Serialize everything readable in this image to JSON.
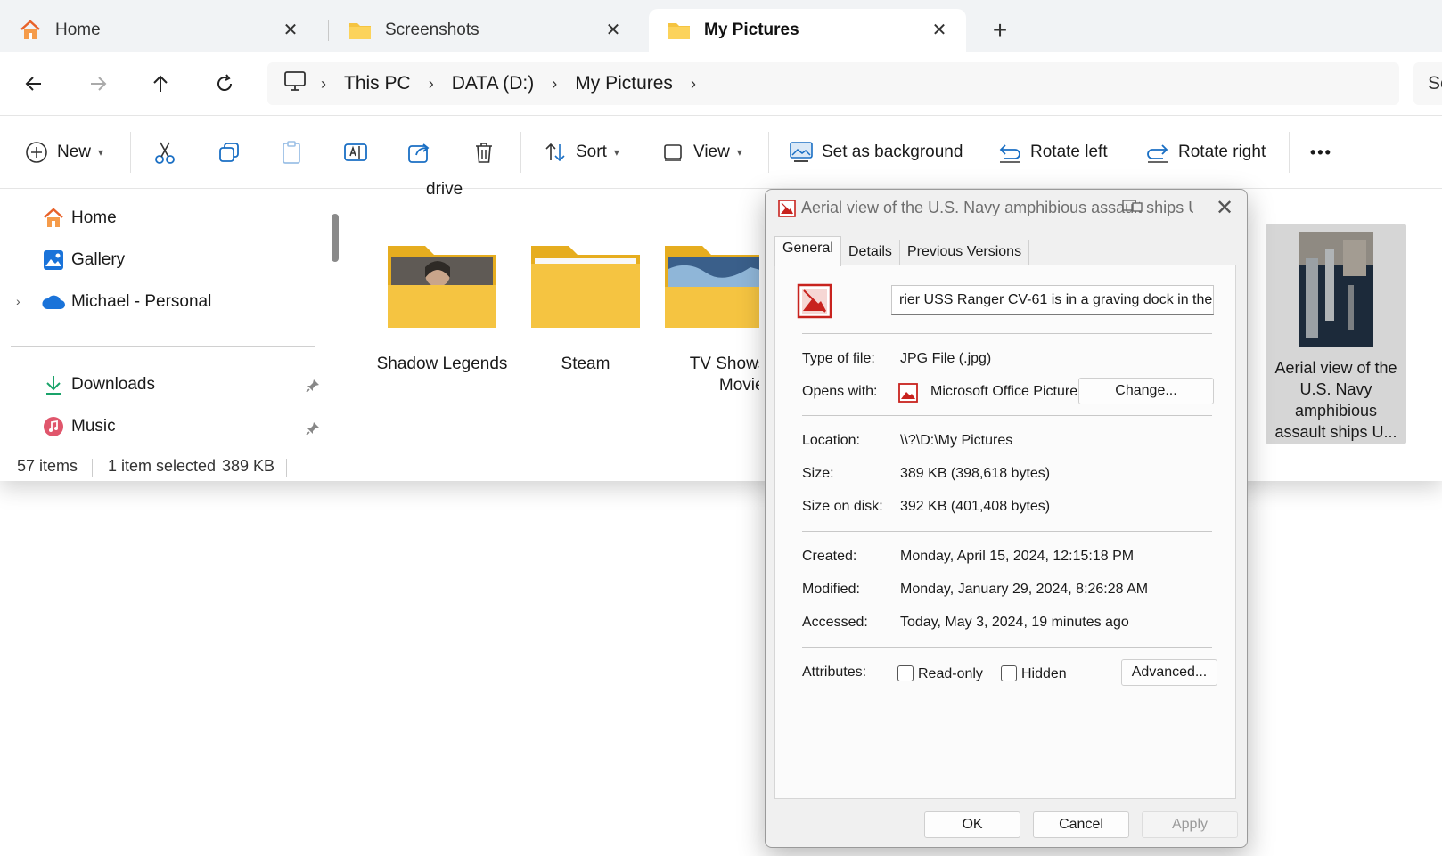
{
  "tabs": [
    {
      "label": "Home",
      "icon": "home-icon"
    },
    {
      "label": "Screenshots",
      "icon": "folder-icon"
    },
    {
      "label": "My Pictures",
      "icon": "folder-icon",
      "active": true
    }
  ],
  "address": {
    "crumbs": [
      "This PC",
      "DATA (D:)",
      "My Pictures"
    ],
    "search_placeholder": "Se"
  },
  "toolbar": {
    "new_label": "New",
    "sort_label": "Sort",
    "view_label": "View",
    "set_background_label": "Set as background",
    "rotate_left_label": "Rotate left",
    "rotate_right_label": "Rotate right",
    "more_label": "•••"
  },
  "sidebar": {
    "items": [
      {
        "label": "Home",
        "icon": "home-icon"
      },
      {
        "label": "Gallery",
        "icon": "gallery-icon"
      },
      {
        "label": "Michael - Personal",
        "icon": "cloud-icon"
      },
      {
        "label": "Downloads",
        "icon": "download-icon"
      },
      {
        "label": "Music",
        "icon": "music-icon"
      }
    ]
  },
  "content": {
    "partial_label": "drive",
    "folders": [
      {
        "label": "Shadow Legends"
      },
      {
        "label": "Steam"
      },
      {
        "label": "TV Shows Movies",
        "line1": "TV Shows",
        "line2": "Movies"
      }
    ],
    "selected_file": {
      "line1": "Aerial view of the",
      "line2": "U.S. Navy",
      "line3": "amphibious",
      "line4": "assault ships U..."
    }
  },
  "status": {
    "items_count": "57 items",
    "selected": "1 item selected",
    "size": "389 KB"
  },
  "dialog": {
    "title": "Aerial view of the U.S. Navy amphibious assault ships U...",
    "tabs": [
      "General",
      "Details",
      "Previous Versions"
    ],
    "name_value": "rier USS Ranger CV-61 is in a graving dock in the",
    "type_label": "Type of file:",
    "type_value": "JPG File (.jpg)",
    "opens_label": "Opens with:",
    "opens_value": "Microsoft Office Picture",
    "change_button": "Change...",
    "location_label": "Location:",
    "location_value": "\\\\?\\D:\\My Pictures",
    "size_label": "Size:",
    "size_value": "389 KB (398,618 bytes)",
    "size_on_disk_label": "Size on disk:",
    "size_on_disk_value": "392 KB (401,408 bytes)",
    "created_label": "Created:",
    "created_value": "Monday, April 15, 2024, 12:15:18 PM",
    "modified_label": "Modified:",
    "modified_value": "Monday, January 29, 2024, 8:26:28 AM",
    "accessed_label": "Accessed:",
    "accessed_value": "Today, May 3, 2024, 19 minutes ago",
    "attributes_label": "Attributes:",
    "readonly_label": "Read-only",
    "hidden_label": "Hidden",
    "advanced_button": "Advanced...",
    "ok_button": "OK",
    "cancel_button": "Cancel",
    "apply_button": "Apply"
  },
  "colors": {
    "folder": "#f5c441",
    "folder_dark": "#e6ad1f",
    "accent": "#0067c0",
    "onedrive": "#1a73d9"
  }
}
